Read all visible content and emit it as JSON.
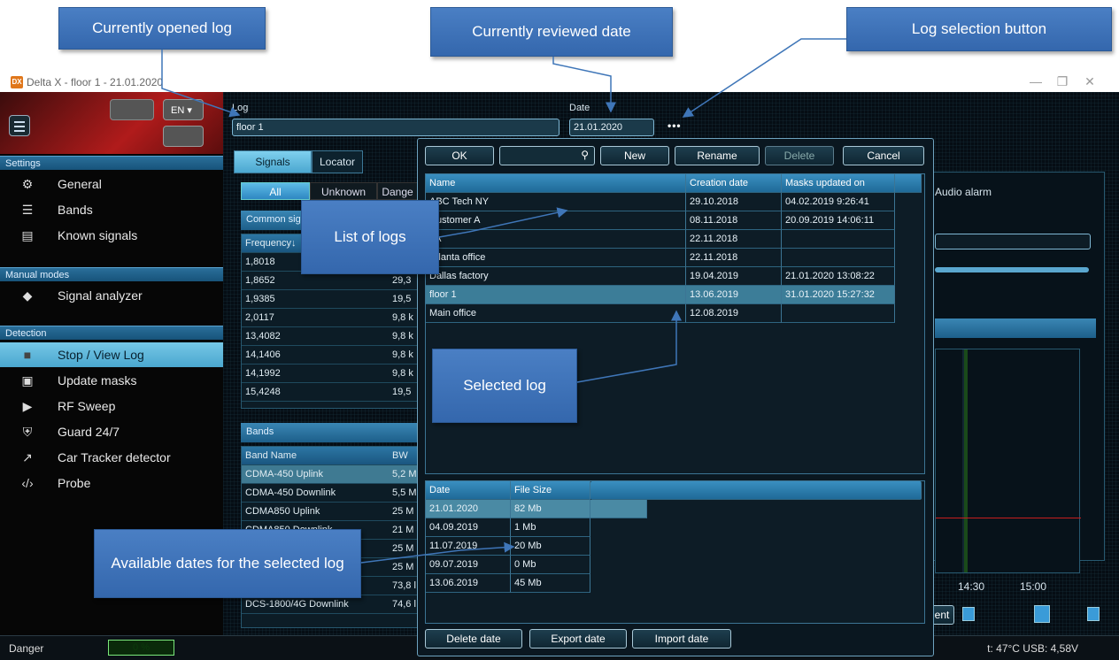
{
  "window": {
    "title": "Delta X - floor 1 - 21.01.2020",
    "app_icon": "DX"
  },
  "callouts": {
    "opened_log": "Currently opened log",
    "reviewed_date": "Currently reviewed date",
    "log_selection": "Log selection button",
    "list_of_logs": "List of logs",
    "selected_log": "Selected log",
    "available_dates": "Available dates for the selected log"
  },
  "sidebar": {
    "lang": "EN",
    "settings_header": "Settings",
    "settings_items": [
      {
        "label": "General",
        "icon": "gear-icon"
      },
      {
        "label": "Bands",
        "icon": "list-icon"
      },
      {
        "label": "Known signals",
        "icon": "clipboard-icon"
      }
    ],
    "manual_header": "Manual modes",
    "manual_items": [
      {
        "label": "Signal analyzer",
        "icon": "signal-icon"
      }
    ],
    "detection_header": "Detection",
    "detection_items": [
      {
        "label": "Stop / View Log",
        "icon": "stop-icon"
      },
      {
        "label": "Update masks",
        "icon": "image-icon"
      },
      {
        "label": "RF Sweep",
        "icon": "play-icon"
      },
      {
        "label": "Guard 24/7",
        "icon": "shield-icon"
      },
      {
        "label": "Car Tracker detector",
        "icon": "trend-icon"
      },
      {
        "label": "Probe",
        "icon": "probe-icon"
      }
    ]
  },
  "main": {
    "log_label": "Log",
    "log_value": "floor 1",
    "date_label": "Date",
    "date_value": "21.01.2020",
    "tabs": [
      "Signals",
      "Locator"
    ],
    "filters": [
      "All",
      "Unknown",
      "Dange"
    ],
    "common_signals_header": "Common sig",
    "freq_header": "Frequency↓",
    "freq_rows": [
      {
        "freq": "1,8018",
        "val": ""
      },
      {
        "freq": "1,8652",
        "val": "29,3"
      },
      {
        "freq": "1,9385",
        "val": "19,5"
      },
      {
        "freq": "2,0117",
        "val": "9,8 k"
      },
      {
        "freq": "13,4082",
        "val": "9,8 k"
      },
      {
        "freq": "14,1406",
        "val": "9,8 k"
      },
      {
        "freq": "14,1992",
        "val": "9,8 k"
      },
      {
        "freq": "15,4248",
        "val": "19,5"
      }
    ],
    "bands_header": "Bands",
    "band_cols": [
      "Band Name",
      "BW"
    ],
    "band_rows": [
      {
        "name": "CDMA-450 Uplink",
        "bw": "5,2 M"
      },
      {
        "name": "CDMA-450 Downlink",
        "bw": "5,5 M"
      },
      {
        "name": "CDMA850 Uplink",
        "bw": "25 M"
      },
      {
        "name": "CDMA850 Downlink",
        "bw": "21 M"
      },
      {
        "name": "",
        "bw": "25 M"
      },
      {
        "name": "",
        "bw": "25 M"
      },
      {
        "name": "",
        "bw": "73,8 l"
      },
      {
        "name": "DCS-1800/4G Downlink",
        "bw": "74,6 l"
      }
    ],
    "audio_alarm": "Audio alarm",
    "time_ticks": [
      "14:30",
      "15:00"
    ],
    "ent_button": "ent"
  },
  "dialog": {
    "ok": "OK",
    "new": "New",
    "rename": "Rename",
    "delete": "Delete",
    "cancel": "Cancel",
    "log_cols": [
      "Name",
      "Creation date",
      "Masks updated on"
    ],
    "logs": [
      {
        "name": "ABC Tech NY",
        "created": "29.10.2018",
        "masks": "04.02.2019 9:26:41"
      },
      {
        "name": "Customer A",
        "created": "08.11.2018",
        "masks": "20.09.2019 14:06:11"
      },
      {
        "name": "LA",
        "created": "22.11.2018",
        "masks": ""
      },
      {
        "name": "Atlanta office",
        "created": "22.11.2018",
        "masks": ""
      },
      {
        "name": "Dallas factory",
        "created": "19.04.2019",
        "masks": "21.01.2020 13:08:22"
      },
      {
        "name": "floor 1",
        "created": "13.06.2019",
        "masks": "31.01.2020 15:27:32"
      },
      {
        "name": "Main office",
        "created": "12.08.2019",
        "masks": ""
      }
    ],
    "date_cols": [
      "Date",
      "File Size"
    ],
    "dates": [
      {
        "date": "21.01.2020",
        "size": "82 Mb"
      },
      {
        "date": "04.09.2019",
        "size": "1 Mb"
      },
      {
        "date": "11.07.2019",
        "size": "20 Mb"
      },
      {
        "date": "09.07.2019",
        "size": "0 Mb"
      },
      {
        "date": "13.06.2019",
        "size": "45 Mb"
      }
    ],
    "delete_date": "Delete date",
    "export_date": "Export date",
    "import_date": "Import date"
  },
  "status": {
    "danger_label": "Danger",
    "danger_value": "0 %",
    "danger_fraction": 0,
    "right": "t: 47°C  USB: 4,58V"
  }
}
